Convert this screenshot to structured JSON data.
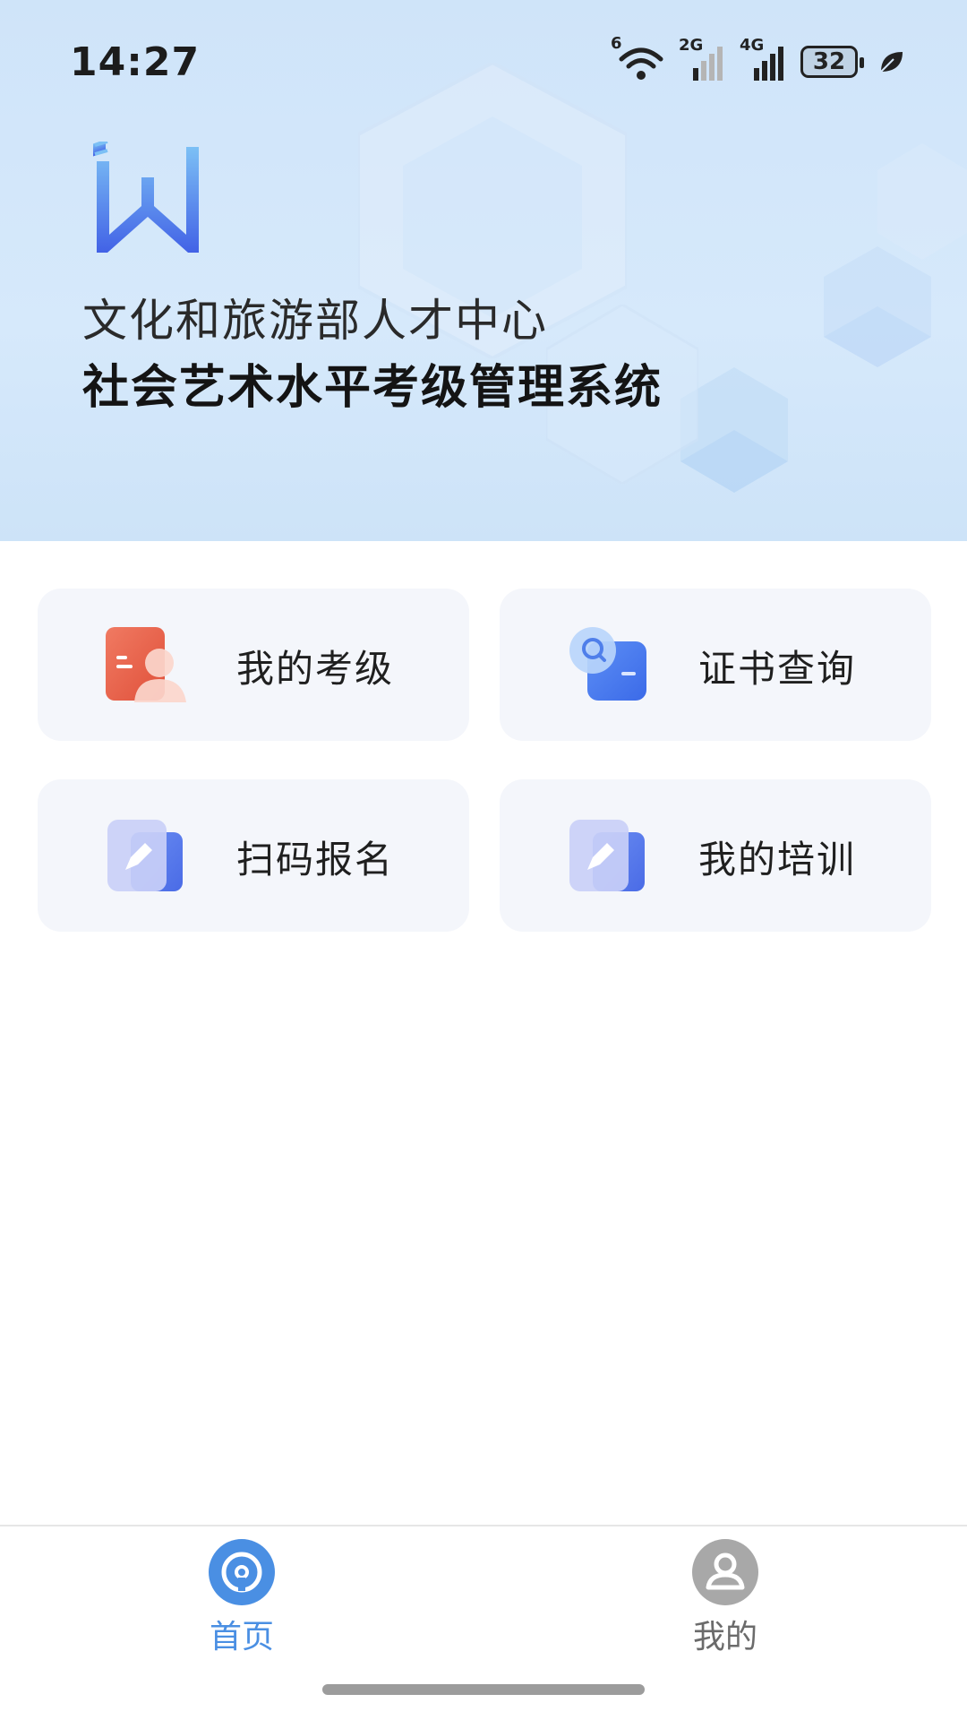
{
  "status_bar": {
    "time": "14:27",
    "wifi_badge": "6",
    "sim1_label": "2G",
    "sim2_label": "4G",
    "battery": "32"
  },
  "header": {
    "org_name": "文化和旅游部人才中心",
    "system_name": "社会艺术水平考级管理系统",
    "logo_icon": "logo-icon"
  },
  "menu": {
    "items": [
      {
        "label": "我的考级",
        "icon": "exam-profile-icon"
      },
      {
        "label": "证书查询",
        "icon": "certificate-search-icon"
      },
      {
        "label": "扫码报名",
        "icon": "scan-register-icon"
      },
      {
        "label": "我的培训",
        "icon": "training-icon"
      }
    ]
  },
  "bottom_nav": {
    "home_label": "首页",
    "mine_label": "我的",
    "active": "home",
    "active_color": "#4a8fe3",
    "inactive_color": "#9e9e9e"
  }
}
